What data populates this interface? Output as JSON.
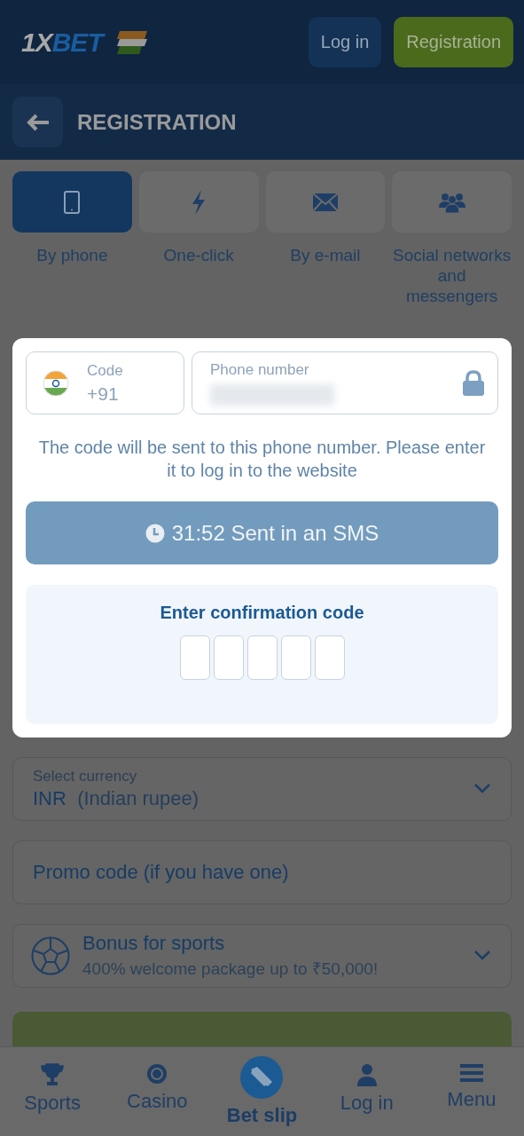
{
  "header": {
    "logo": {
      "first": "1X",
      "second": "BET"
    },
    "buttons": [
      {
        "label": "Log in",
        "kind": "secondary"
      },
      {
        "label": "Registration",
        "kind": "primary"
      }
    ]
  },
  "page_title": "REGISTRATION",
  "methods": [
    {
      "label": "By phone",
      "selected": true
    },
    {
      "label": "One-click",
      "selected": false
    },
    {
      "label": "By e-mail",
      "selected": false
    },
    {
      "label": "Social networks and messengers",
      "selected": false
    }
  ],
  "dialog": {
    "code": {
      "label": "Code",
      "value": "+91"
    },
    "phone": {
      "label": "Phone number",
      "locked": true
    },
    "hint": "The code will be sent to this phone number. Please enter it to log in to the website",
    "sms_button": "31:52 Sent in an SMS",
    "confirm_title": "Enter confirmation code",
    "code_cells": [
      {
        "filled": false
      },
      {
        "filled": false
      },
      {
        "filled": false
      },
      {
        "filled": false
      },
      {
        "filled": false
      }
    ]
  },
  "currency": {
    "label": "Select currency",
    "code": "INR",
    "name": "(Indian rupee)"
  },
  "promo": {
    "placeholder": "Promo code (if you have one)"
  },
  "bonus": {
    "title": "Bonus for sports",
    "subtitle": "400% welcome package up to ₹50,000!"
  },
  "nav": [
    {
      "label": "Sports",
      "selected": false
    },
    {
      "label": "Casino",
      "selected": false
    },
    {
      "label": "Bet slip",
      "selected": true
    },
    {
      "label": "Log in",
      "selected": false
    },
    {
      "label": "Menu",
      "selected": false
    }
  ]
}
